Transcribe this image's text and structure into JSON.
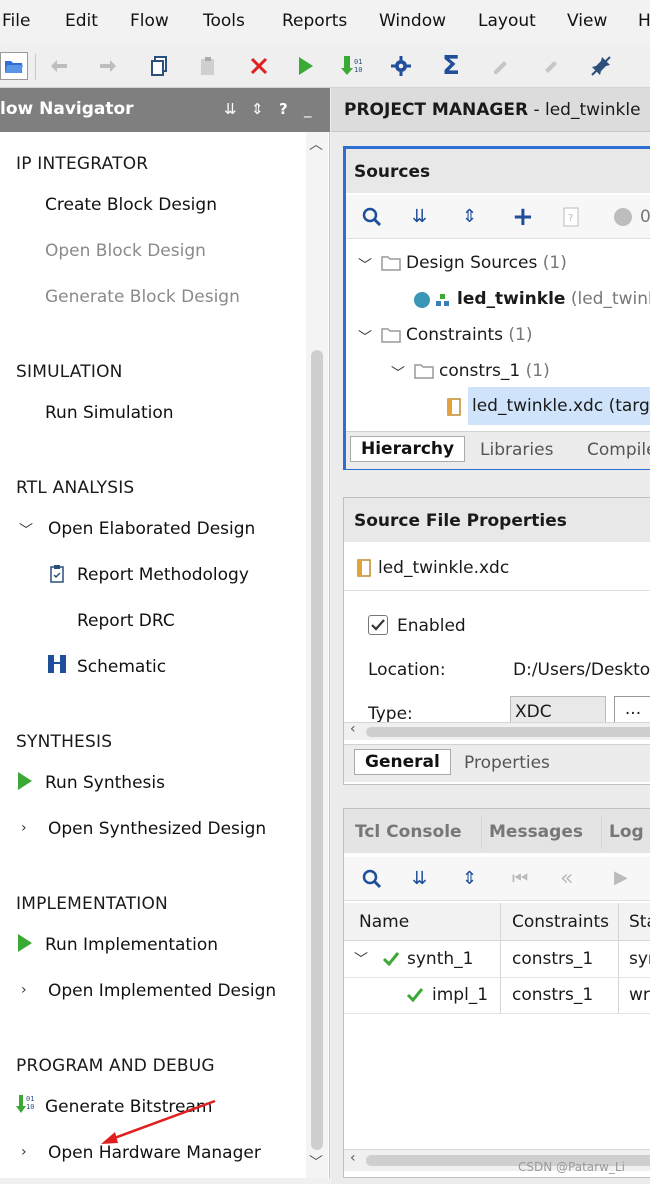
{
  "menu": [
    "File",
    "Edit",
    "Flow",
    "Tools",
    "Reports",
    "Window",
    "Layout",
    "View",
    "H"
  ],
  "flow_navigator": {
    "title": "low Navigator",
    "sections": [
      {
        "label": "IP INTEGRATOR",
        "items": [
          {
            "label": "Create Block Design"
          },
          {
            "label": "Open Block Design"
          },
          {
            "label": "Generate Block Design"
          }
        ]
      },
      {
        "label": "SIMULATION",
        "items": [
          {
            "label": "Run Simulation"
          }
        ]
      },
      {
        "label": "RTL ANALYSIS",
        "items": [
          {
            "label": "Open Elaborated Design"
          },
          {
            "label": "Report Methodology"
          },
          {
            "label": "Report DRC"
          },
          {
            "label": "Schematic"
          }
        ]
      },
      {
        "label": "SYNTHESIS",
        "items": [
          {
            "label": "Run Synthesis"
          },
          {
            "label": "Open Synthesized Design"
          }
        ]
      },
      {
        "label": "IMPLEMENTATION",
        "items": [
          {
            "label": "Run Implementation"
          },
          {
            "label": "Open Implemented Design"
          }
        ]
      },
      {
        "label": "PROGRAM AND DEBUG",
        "items": [
          {
            "label": "Generate Bitstream"
          },
          {
            "label": "Open Hardware Manager"
          }
        ]
      }
    ]
  },
  "project_manager": {
    "title": "PROJECT MANAGER",
    "separator": "-",
    "project": "led_twinkle"
  },
  "sources": {
    "title": "Sources",
    "toolbar_count": "0",
    "tree": {
      "design_sources": {
        "label": "Design Sources",
        "count": "(1)"
      },
      "top": {
        "label": "led_twinkle",
        "suffix": "(led_twinkle"
      },
      "constraints": {
        "label": "Constraints",
        "count": "(1)"
      },
      "constrs": {
        "label": "constrs_1",
        "count": "(1)"
      },
      "xdc": {
        "label": "led_twinkle.xdc (target"
      }
    },
    "tabs": [
      "Hierarchy",
      "Libraries",
      "Compile"
    ]
  },
  "source_file_properties": {
    "title": "Source File Properties",
    "file": "led_twinkle.xdc",
    "enabled_label": "Enabled",
    "location_label": "Location:",
    "location_value": "D:/Users/Desktop",
    "type_label": "Type:",
    "type_value": "XDC",
    "more_button": "...",
    "tabs": [
      "General",
      "Properties"
    ]
  },
  "console": {
    "tabs": [
      "Tcl Console",
      "Messages",
      "Log"
    ],
    "columns": [
      "Name",
      "Constraints",
      "Sta"
    ],
    "rows": [
      {
        "name": "synth_1",
        "constraints": "constrs_1",
        "status": "syn"
      },
      {
        "name": "impl_1",
        "constraints": "constrs_1",
        "status": "wri"
      }
    ]
  },
  "watermark": "CSDN @Patarw_Li",
  "colors": {
    "accent_blue": "#2e6fd3",
    "run_green": "#3aaa35",
    "stop_red": "#e02020",
    "highlight": "#cfe4fb"
  }
}
